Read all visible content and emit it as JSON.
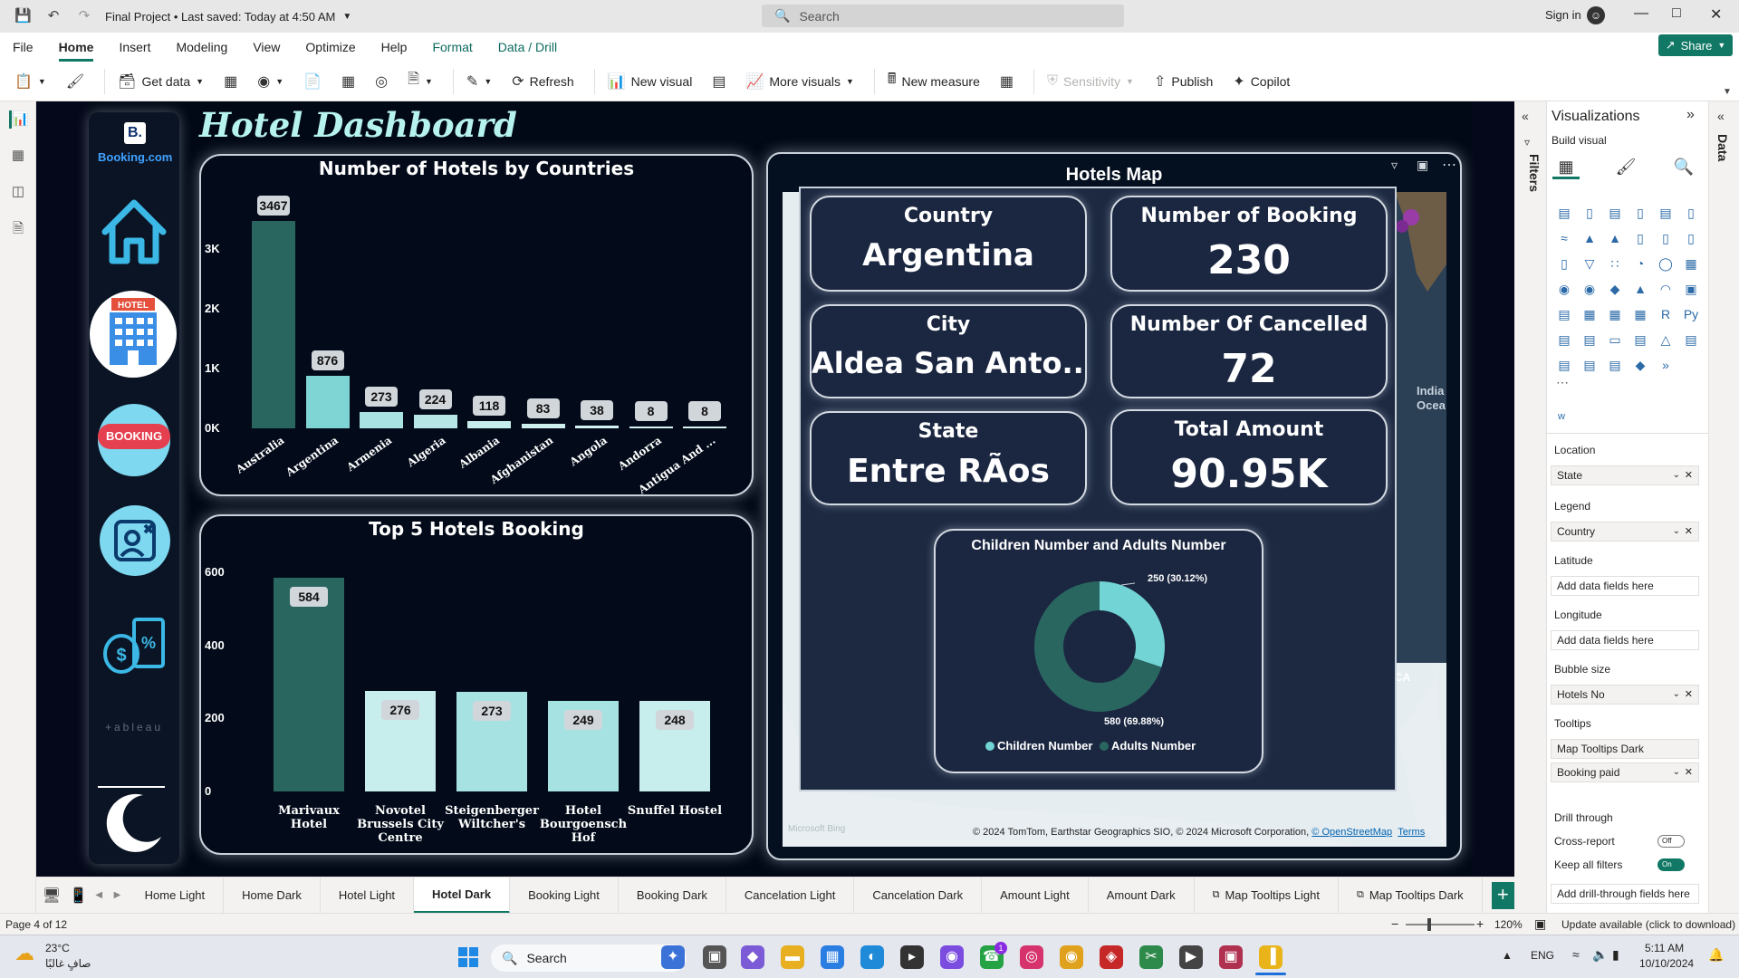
{
  "window": {
    "title": "Final Project • Last saved: Today at 4:50 AM",
    "search_placeholder": "Search",
    "sign_in": "Sign in"
  },
  "menu": {
    "items": [
      "File",
      "Home",
      "Insert",
      "Modeling",
      "View",
      "Optimize",
      "Help",
      "Format",
      "Data / Drill"
    ],
    "active": "Home",
    "share": "Share"
  },
  "toolbar": {
    "get_data": "Get data",
    "refresh": "Refresh",
    "new_visual": "New visual",
    "more_visuals": "More visuals",
    "new_measure": "New measure",
    "sensitivity": "Sensitivity",
    "publish": "Publish",
    "copilot": "Copilot"
  },
  "dashboard": {
    "title": "Hotel Dashboard",
    "logo_text": "Booking.com",
    "tableau_text": "+ableau"
  },
  "chart_data": [
    {
      "type": "bar",
      "title": "Number of Hotels by Countries",
      "categories": [
        "Australia",
        "Argentina",
        "Armenia",
        "Algeria",
        "Albania",
        "Afghanistan",
        "Angola",
        "Andorra",
        "Antigua And ..."
      ],
      "values": [
        3467,
        876,
        273,
        224,
        118,
        83,
        38,
        8,
        8
      ],
      "yticks": [
        "0K",
        "1K",
        "2K",
        "3K"
      ],
      "ylim": [
        0,
        3600
      ],
      "colors": [
        "#2a6660",
        "#7fd4d4",
        "#a8e2e2",
        "#b6e6e6",
        "#c6ecec",
        "#cfeeee",
        "#d6f1f1",
        "#d9f2f2",
        "#d9f2f2"
      ]
    },
    {
      "type": "bar",
      "title": "Top 5 Hotels Booking",
      "categories": [
        "Marivaux Hotel",
        "Novotel Brussels City Centre",
        "Steigenberger Wiltcher's",
        "Hotel Bourgoensch Hof",
        "Snuffel Hostel"
      ],
      "category_lines": [
        [
          "Marivaux",
          "Hotel"
        ],
        [
          "Novotel",
          "Brussels City",
          "Centre"
        ],
        [
          "Steigenberger",
          "Wiltcher's"
        ],
        [
          "Hotel",
          "Bourgoensch",
          "Hof"
        ],
        [
          "Snuffel Hostel"
        ]
      ],
      "values": [
        584,
        276,
        273,
        249,
        248
      ],
      "yticks": [
        "0",
        "200",
        "400",
        "600"
      ],
      "ylim": [
        0,
        600
      ],
      "colors": [
        "#2a6660",
        "#c8eded",
        "#a6e2e2",
        "#a6e2e2",
        "#c8eded"
      ]
    },
    {
      "type": "pie",
      "title": "Children Number and Adults Number",
      "labels": [
        "Children Number",
        "Adults Number"
      ],
      "values": [
        250,
        580
      ],
      "data_labels": [
        "250 (30.12%)",
        "580 (69.88%)"
      ],
      "colors": [
        "#72d4d4",
        "#2a6660"
      ],
      "donut": true,
      "legend_position": "bottom"
    }
  ],
  "map": {
    "title": "Hotels Map",
    "kpis": [
      {
        "label": "Country",
        "value": "Argentina"
      },
      {
        "label": "Number of Booking",
        "value": "230"
      },
      {
        "label": "City",
        "value": "Aldea San Anto..."
      },
      {
        "label": "Number Of Cancelled",
        "value": "72"
      },
      {
        "label": "State",
        "value": "Entre RÃos"
      },
      {
        "label": "Total Amount",
        "value": "90.95K"
      }
    ],
    "ocean_label_1": "India",
    "ocean_label_2": "Ocea",
    "attribution": "© 2024 TomTom, Earthstar Geographics SIO, © 2024 Microsoft Corporation, ",
    "osm": "© OpenStreetMap",
    "terms": "Terms",
    "bing": "Microsoft Bing",
    "ca": "CA"
  },
  "viz_pane": {
    "title": "Visualizations",
    "filters": "Filters",
    "data": "Data",
    "build_visual": "Build visual",
    "w_label": "w",
    "wells": [
      {
        "header": "Location",
        "field": "State"
      },
      {
        "header": "Legend",
        "field": "Country"
      },
      {
        "header": "Latitude",
        "placeholder": "Add data fields here"
      },
      {
        "header": "Longitude",
        "placeholder": "Add data fields here"
      },
      {
        "header": "Bubble size",
        "field": "Hotels No"
      },
      {
        "header": "Tooltips",
        "field": "Map Tooltips Dark"
      }
    ],
    "tooltip_field_2": "Booking paid",
    "drill_through": "Drill through",
    "cross_report": "Cross-report",
    "cross_report_state": "Off",
    "keep_filters": "Keep all filters",
    "keep_filters_state": "On",
    "drill_placeholder": "Add drill-through fields here"
  },
  "page_tabs": [
    "Home Light",
    "Home Dark",
    "Hotel Light",
    "Hotel Dark",
    "Booking Light",
    "Booking Dark",
    "Cancelation Light",
    "Cancelation Dark",
    "Amount Light",
    "Amount Dark",
    "Map Tooltips Light",
    "Map Tooltips Dark"
  ],
  "active_tab": "Hotel Dark",
  "status": {
    "page": "Page 4 of 12",
    "zoom": "120%",
    "update": "Update available (click to download)"
  },
  "taskbar": {
    "temp": "23°C",
    "weather": "صافٍ غالبًا",
    "search": "Search",
    "lang": "ENG",
    "time": "5:11 AM",
    "date": "10/10/2024",
    "badge": "1"
  }
}
